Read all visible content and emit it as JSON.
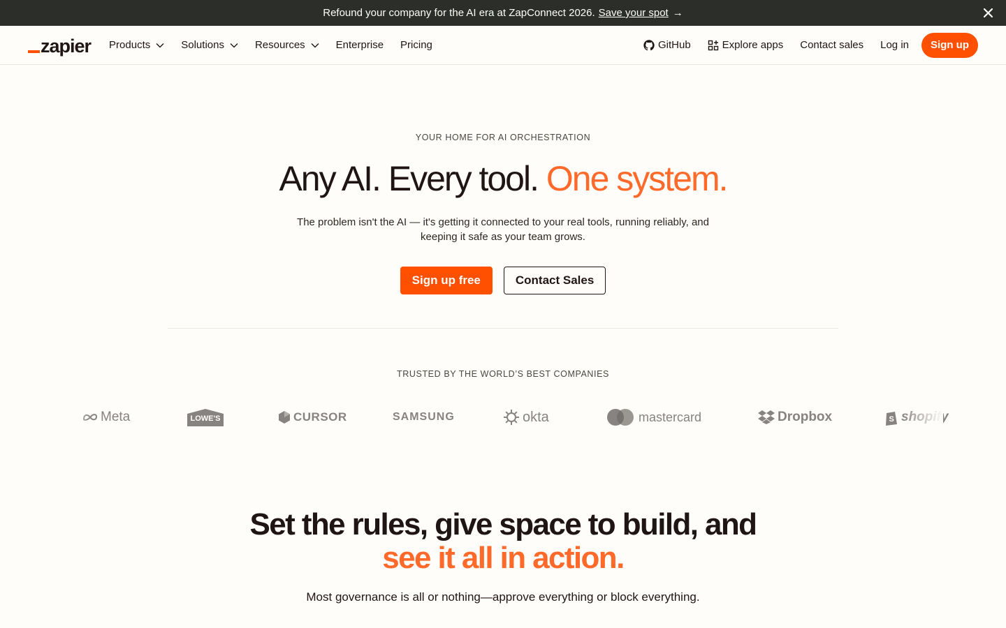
{
  "banner": {
    "text": "Refound your company for the AI era at ZapConnect 2026.",
    "link": "Save your spot",
    "arrow": "→",
    "close_icon": "close-icon"
  },
  "nav": {
    "logo": "zapier",
    "items": [
      {
        "label": "Products",
        "dropdown": true
      },
      {
        "label": "Solutions",
        "dropdown": true
      },
      {
        "label": "Resources",
        "dropdown": true
      },
      {
        "label": "Enterprise",
        "dropdown": false
      },
      {
        "label": "Pricing",
        "dropdown": false
      }
    ],
    "right": {
      "github": "GitHub",
      "explore": "Explore apps",
      "contact": "Contact sales",
      "login": "Log in",
      "signup": "Sign up"
    }
  },
  "hero": {
    "eyebrow": "YOUR HOME FOR AI ORCHESTRATION",
    "title_main": "Any AI. Every tool.",
    "title_accent": "One system.",
    "subtitle": "The problem isn't the AI — it's getting it connected to your real tools, running reliably, and keeping it safe as your team grows.",
    "primary_cta": "Sign up free",
    "secondary_cta": "Contact Sales"
  },
  "trusted": {
    "heading": "TRUSTED BY THE WORLD’S BEST COMPANIES",
    "logos": [
      "Meta",
      "LOWE'S",
      "CURSOR",
      "SAMSUNG",
      "okta",
      "mastercard",
      "Dropbox",
      "shopify"
    ]
  },
  "section2": {
    "title_main": "Set the rules, give space to build, and",
    "title_accent": "see it all in action.",
    "subtitle": "Most governance is all or nothing—approve everything or block everything."
  },
  "colors": {
    "accent": "#ff4f00",
    "accent_text": "#ff6a2b",
    "banner_bg": "#2b2e29",
    "page_bg": "#fffdf9"
  }
}
